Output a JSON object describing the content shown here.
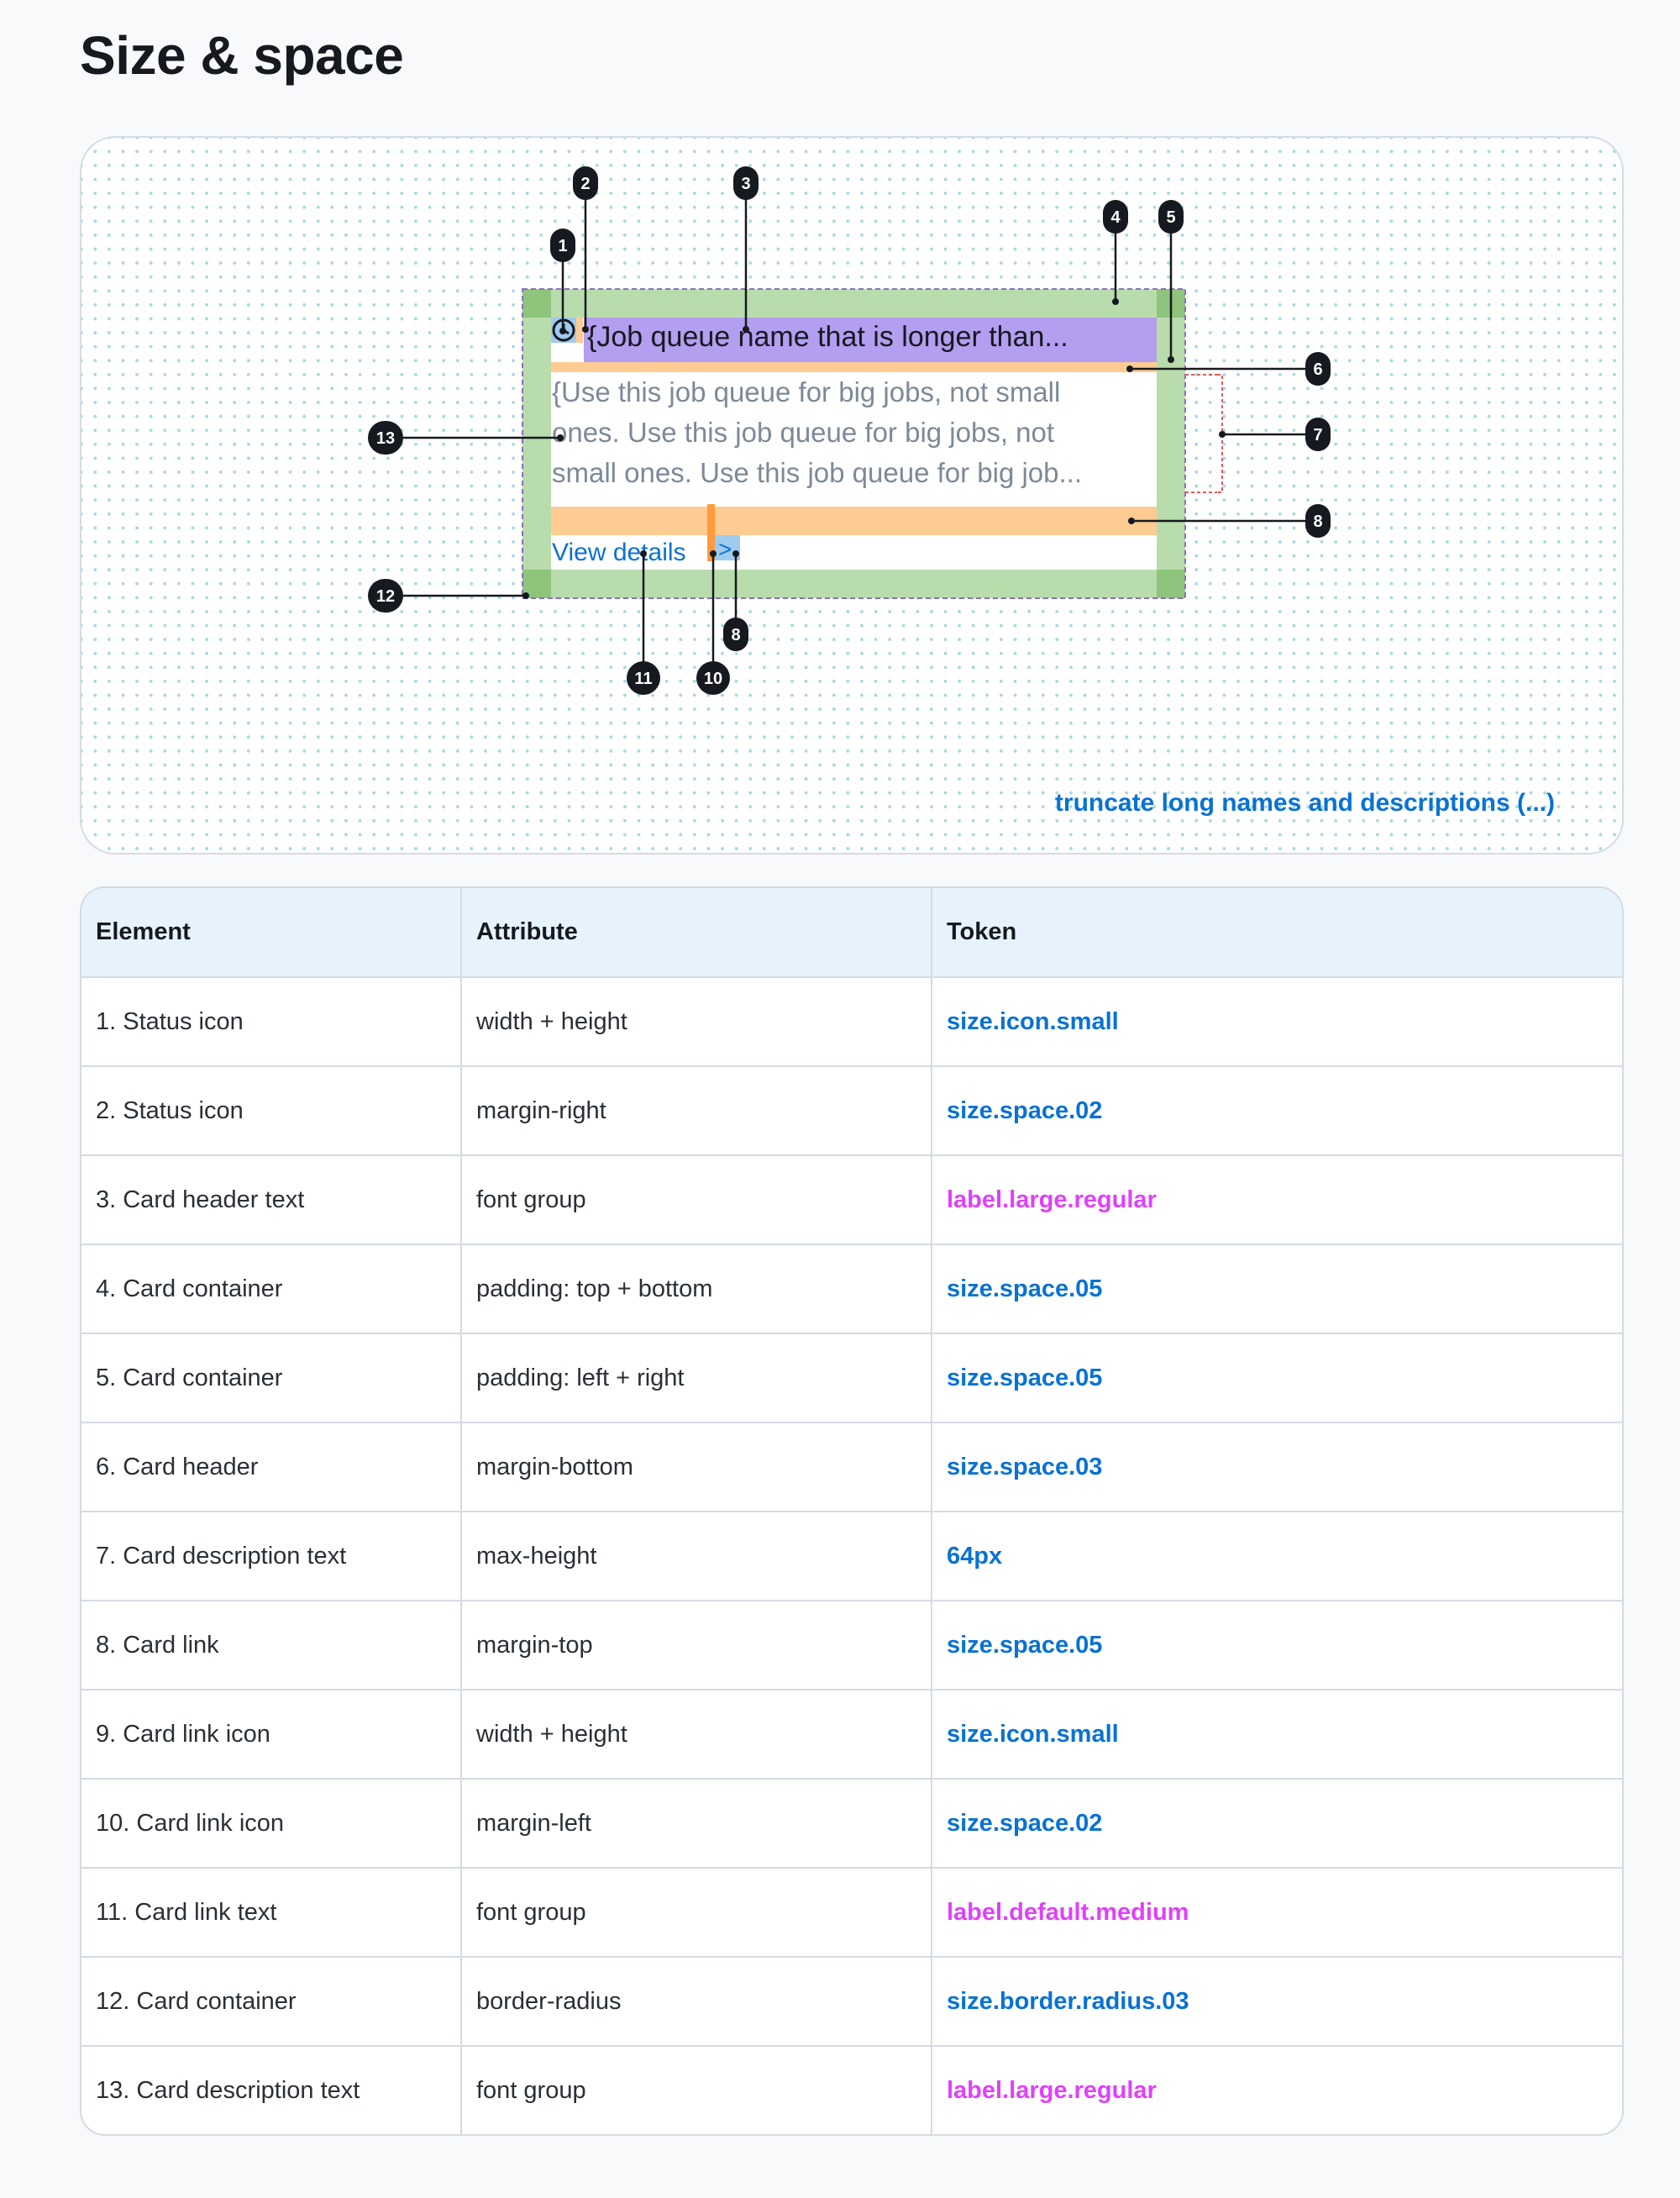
{
  "page_title": "Size & space",
  "diagram": {
    "card": {
      "header_text": "{Job queue name that is longer than...",
      "description_lines": [
        "{Use this job queue for big jobs, not small",
        "ones. Use this job queue for big jobs, not",
        "small ones. Use this job queue for big job..."
      ],
      "link_text": "View details",
      "link_icon": ">"
    },
    "status_icon": "clock-icon",
    "callout_numbers": [
      "1",
      "2",
      "3",
      "4",
      "5",
      "6",
      "7",
      "8",
      "8",
      "10",
      "11",
      "12",
      "13"
    ],
    "caption": "truncate long names and descriptions (...)",
    "colors": {
      "padding_green": "#b9dcac",
      "padding_green_dark": "#8fc47c",
      "margin_orange": "#fecb92",
      "text_purple": "#b39ef0",
      "icon_blue": "#9ecbee",
      "link_blue": "#0972d3",
      "token_pink": "#e040fb"
    }
  },
  "table": {
    "headers": [
      "Element",
      "Attribute",
      "Token"
    ],
    "rows": [
      {
        "element": "1. Status icon",
        "attribute": "width + height",
        "token": "size.icon.small",
        "token_color": "blue"
      },
      {
        "element": "2. Status icon",
        "attribute": "margin-right",
        "token": "size.space.02",
        "token_color": "blue"
      },
      {
        "element": "3. Card header text",
        "attribute": "font group",
        "token": "label.large.regular",
        "token_color": "pink"
      },
      {
        "element": "4. Card container",
        "attribute": "padding: top + bottom",
        "token": "size.space.05",
        "token_color": "blue"
      },
      {
        "element": "5. Card container",
        "attribute": "padding: left + right",
        "token": "size.space.05",
        "token_color": "blue"
      },
      {
        "element": "6. Card header",
        "attribute": "margin-bottom",
        "token": "size.space.03",
        "token_color": "blue"
      },
      {
        "element": "7. Card description text",
        "attribute": "max-height",
        "token": "64px",
        "token_color": "blue"
      },
      {
        "element": "8. Card link",
        "attribute": "margin-top",
        "token": "size.space.05",
        "token_color": "blue"
      },
      {
        "element": "9. Card link icon",
        "attribute": "width + height",
        "token": "size.icon.small",
        "token_color": "blue"
      },
      {
        "element": "10. Card link icon",
        "attribute": "margin-left",
        "token": "size.space.02",
        "token_color": "blue"
      },
      {
        "element": "11. Card link text",
        "attribute": "font group",
        "token": "label.default.medium",
        "token_color": "pink"
      },
      {
        "element": "12. Card container",
        "attribute": "border-radius",
        "token": "size.border.radius.03",
        "token_color": "blue"
      },
      {
        "element": "13. Card description text",
        "attribute": "font group",
        "token": "label.large.regular",
        "token_color": "pink"
      }
    ]
  }
}
